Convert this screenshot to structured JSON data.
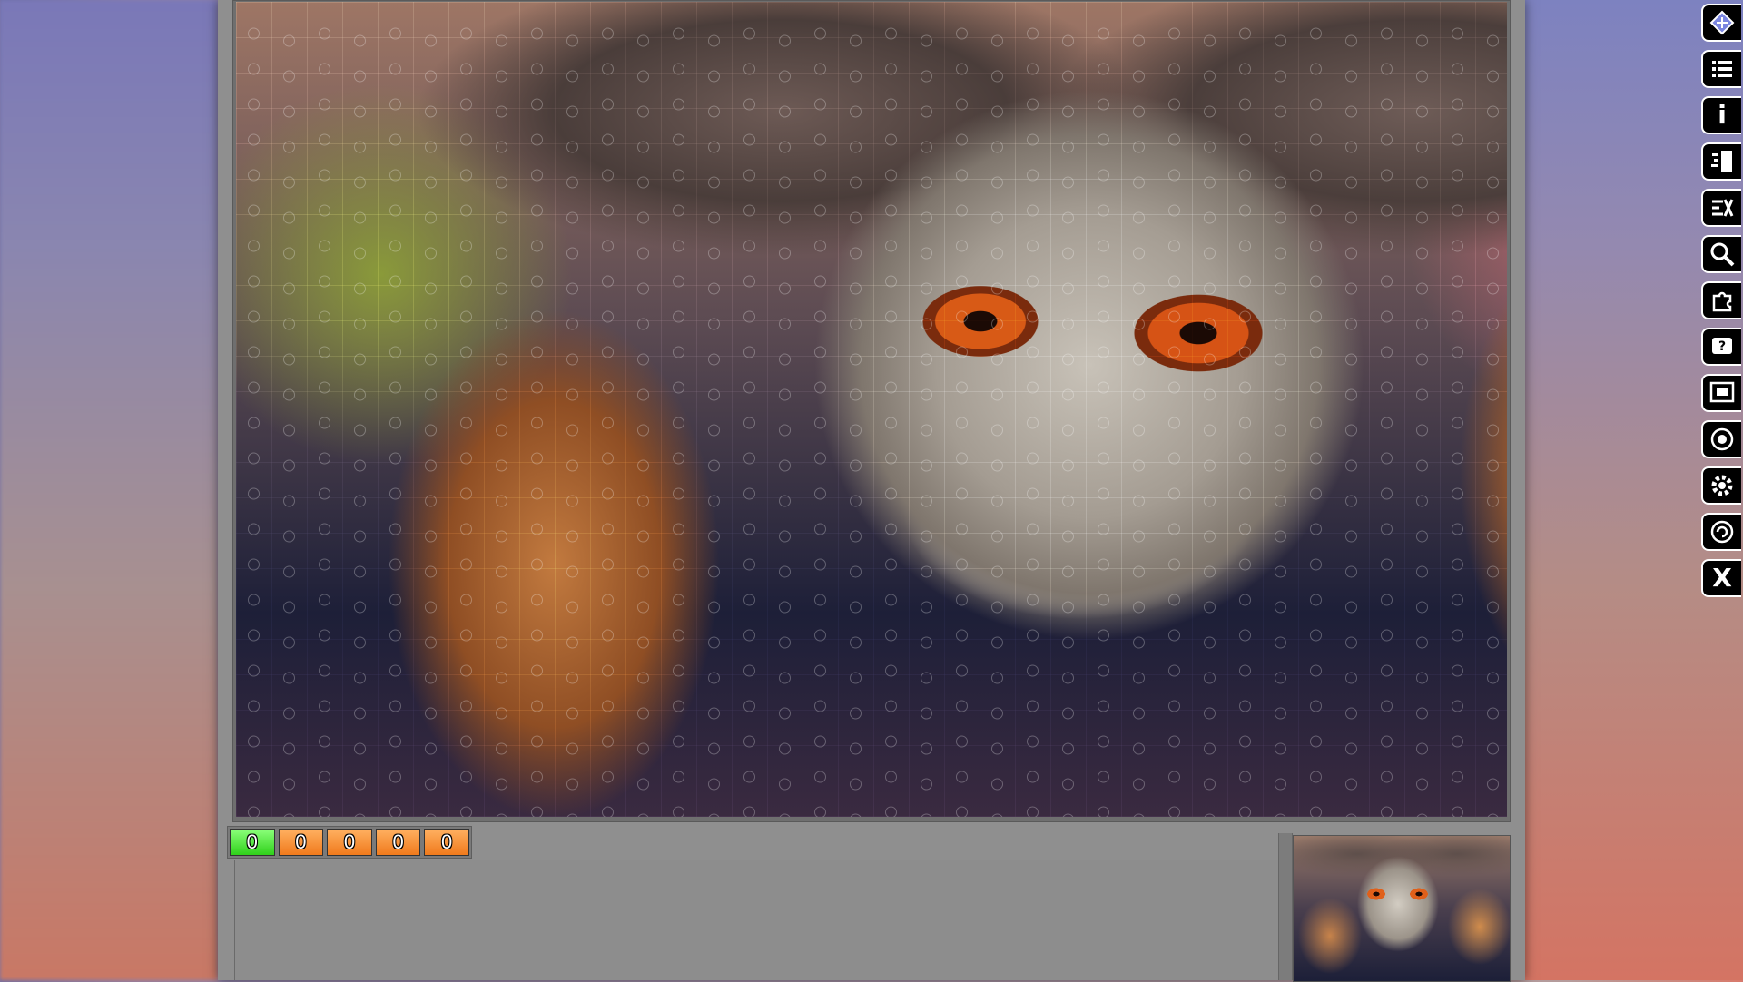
{
  "counters": {
    "placed": "0",
    "c2": "0",
    "c3": "0",
    "c4": "0",
    "c5": "0"
  },
  "colors": {
    "counter_green": "#3fd62a",
    "counter_orange": "#f28424",
    "toolbar_bg": "#000000"
  },
  "toolbar": {
    "icons": [
      "puzzle-logo-icon",
      "menu-list-icon",
      "info-icon",
      "scatter-pieces-icon",
      "sort-pieces-icon",
      "zoom-icon",
      "piece-shape-icon",
      "hint-icon",
      "preview-toggle-icon",
      "background-icon",
      "settings-icon",
      "rotate-icon",
      "close-icon"
    ],
    "info_label": "i",
    "close_label": "X"
  }
}
